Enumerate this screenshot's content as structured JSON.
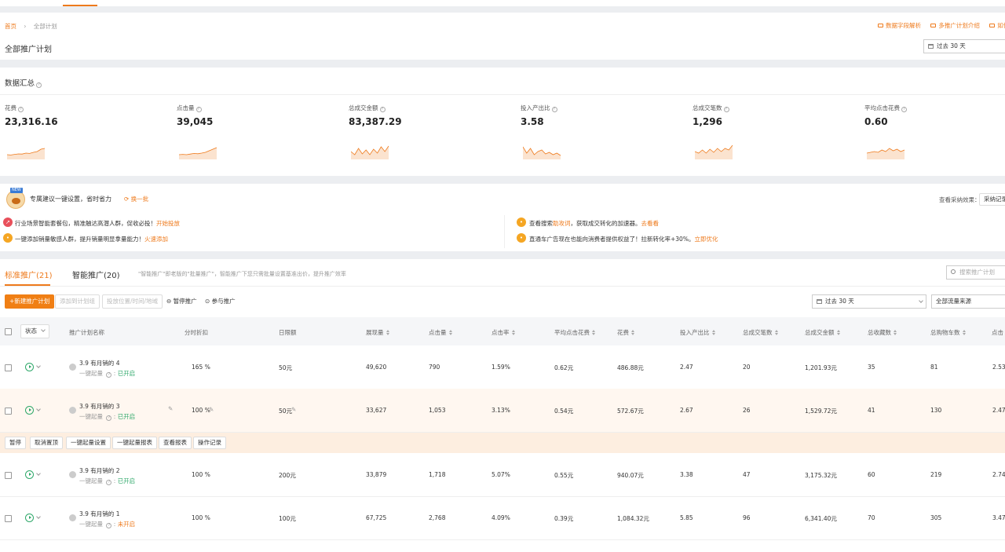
{
  "breadcrumb": {
    "home": "首页",
    "sep": "›",
    "current": "全部计划"
  },
  "page_title": "全部推广计划",
  "top_links": [
    "数据字段解析",
    "多推广计划介绍",
    "如何"
  ],
  "header_date": "过去 30 天",
  "summary": {
    "title": "数据汇总",
    "metrics": [
      {
        "label": "花费",
        "value": "23,316.16"
      },
      {
        "label": "点击量",
        "value": "39,045"
      },
      {
        "label": "总成交金额",
        "value": "83,387.29"
      },
      {
        "label": "投入产出比",
        "value": "3.58"
      },
      {
        "label": "总成交笔数",
        "value": "1,296"
      },
      {
        "label": "平均点击花费",
        "value": "0.60"
      }
    ]
  },
  "suggest": {
    "badge": "NEW",
    "title": "专属建议一键设置，省时省力",
    "refresh": "换一批",
    "effect_label": "查看采纳效果：",
    "effect_btn": "采纳记录",
    "items": [
      {
        "text": "行业场景智能套餐包，精准触达高潜人群，促收必投！",
        "link": "开始投放",
        "color": "#e8505b"
      },
      {
        "text": "一键添加销量敏感人群，提升销量明显拿量能力！",
        "link": "火速添加",
        "color": "#f5a623"
      },
      {
        "text": "查看搜索",
        "link_inline": "助攻词",
        "text2": "，获取成交转化的加速器。",
        "link": "去看看",
        "color": "#f5a623"
      },
      {
        "text": "直通车广告现在也能向消费者提供权益了！拉新转化率+30%。",
        "link": "立即优化",
        "color": "#f5a623"
      }
    ]
  },
  "tabs": {
    "standard": "标准推广(21)",
    "smart": "智能推广(20)",
    "note": "\"智能推广\"即老版的\"批量推广\"，智能推广下您只需批量设置基准出价，提升推广效率",
    "search_placeholder": "搜索推广计划"
  },
  "toolbar": {
    "new_plan": "+新建推广计划",
    "add_to_plan": "添加到计划组",
    "placement": "投放位置/时间/地域",
    "pause": "暂停推广",
    "join": "参与推广",
    "date": "过去 30 天",
    "source": "全部流量来源"
  },
  "table": {
    "status_filter": "状态",
    "headers": [
      "推广计划名称",
      "分时折扣",
      "日限额",
      "展现量",
      "点击量",
      "点击率",
      "平均点击花费",
      "花费",
      "投入产出比",
      "总成交笔数",
      "总成交金额",
      "总收藏数",
      "总购物车数",
      "点击"
    ],
    "sub_label": "一键起量",
    "rows": [
      {
        "name": "3.9 有月销的 4",
        "status": "已开启",
        "discount": "165 %",
        "limit": "50元",
        "impr": "49,620",
        "clicks": "790",
        "ctr": "1.59%",
        "cpc": "0.62元",
        "cost": "486.88元",
        "roi": "2.47",
        "orders": "20",
        "amount": "1,201.93元",
        "fav": "35",
        "cart": "81",
        "cvr": "2.53%"
      },
      {
        "name": "3.9 有月销的 3",
        "status": "已开启",
        "discount": "100 %",
        "limit": "50元",
        "impr": "33,627",
        "clicks": "1,053",
        "ctr": "3.13%",
        "cpc": "0.54元",
        "cost": "572.67元",
        "roi": "2.67",
        "orders": "26",
        "amount": "1,529.72元",
        "fav": "41",
        "cart": "130",
        "cvr": "2.47%"
      },
      {
        "name": "3.9 有月销的 2",
        "status": "已开启",
        "discount": "100 %",
        "limit": "200元",
        "impr": "33,879",
        "clicks": "1,718",
        "ctr": "5.07%",
        "cpc": "0.55元",
        "cost": "940.07元",
        "roi": "3.38",
        "orders": "47",
        "amount": "3,175.32元",
        "fav": "60",
        "cart": "219",
        "cvr": "2.74%"
      },
      {
        "name": "3.9 有月销的 1",
        "status": "未开启",
        "discount": "100 %",
        "limit": "100元",
        "impr": "67,725",
        "clicks": "2,768",
        "ctr": "4.09%",
        "cpc": "0.39元",
        "cost": "1,084.32元",
        "roi": "5.85",
        "orders": "96",
        "amount": "6,341.40元",
        "fav": "70",
        "cart": "305",
        "cvr": "3.47%"
      }
    ],
    "row_actions": [
      "暂停",
      "取消置顶",
      "一键起量设置",
      "一键起量报表",
      "查看报表",
      "操作记录"
    ]
  },
  "colors": {
    "accent": "#ee7a1c",
    "green": "#2fa86a",
    "hover_row": "#fff7f0"
  }
}
